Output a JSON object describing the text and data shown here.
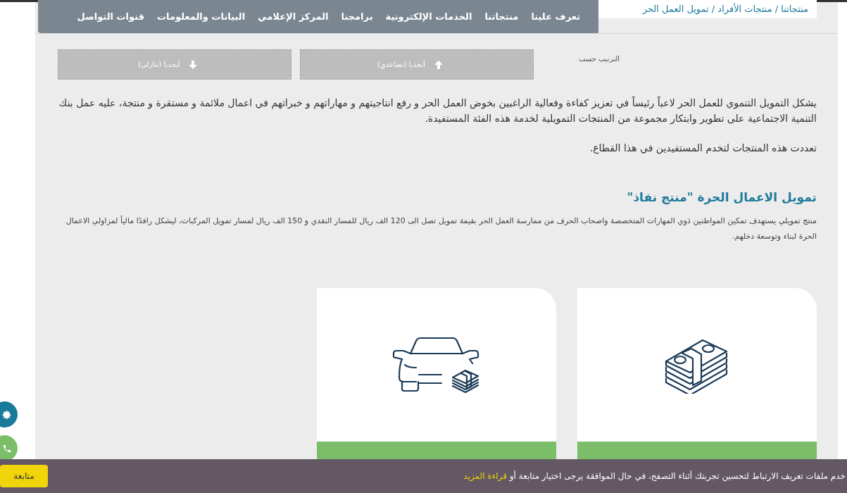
{
  "nav": {
    "items": [
      "تعرف علينا",
      "منتجاتنا",
      "الخدمات الإلكترونية",
      "برامجنا",
      "المركز الإعلامي",
      "البيانات والمعلومات",
      "قنوات التواصل"
    ]
  },
  "breadcrumb": "منتجاتنا / منتجات الأفراد / تمويل العمل الحر",
  "sort": {
    "label": "الترتيب حسب",
    "options": [
      {
        "label": "أبجديا (تصاعدي)",
        "kind": "up"
      },
      {
        "label": "أبجديا (تنازلي)",
        "kind": "down"
      }
    ]
  },
  "intro": [
    "يشكل التمويل التنموي للعمل الحر لاعباً رئيساً في تعزيز كفاءة وفعالية الراغبين بخوض العمل الحر و رفع انتاجيتهم و مهاراتهم و خبراتهم في اعمال ملائمة و مستقرة و منتجة،   عليه عمل بنك التنمية الاجتماعية على تطوير وابتكار مجموعة من المنتجات التمويلية لخدمة هذه الفئة المستفيدة.",
    "تعددت هذه المنتجات لتخدم المستفيدين في هذا القطاع."
  ],
  "product": {
    "title": "تمويل الاعمال الحرة \"منتج نفاذ\"",
    "description": "منتج تمويلي يستهدف تمكين المواطنين ذوي المهارات المتخصصة واصحاب الحرف من ممارسة العمل الحر بقيمة تمويل تصل الى 120 الف ريال للمسار النقدي و 150 الف ريال لمسار تمويل المركبات، ليشكل رافدًا مالياً لمزاولي الاعمال الحرة لبناء وتوسعة دخلهم."
  },
  "cards": [
    {
      "kind": "cash"
    },
    {
      "kind": "car"
    }
  ],
  "cookie_bar": {
    "text": "خدم ملفات تعريف الارتباط لتحسين تجربتك أثناء التصفح، في حال الموافقة يرجى اختيار متابعة أو",
    "link": "قراءة المزيد",
    "button": "متابعة"
  }
}
